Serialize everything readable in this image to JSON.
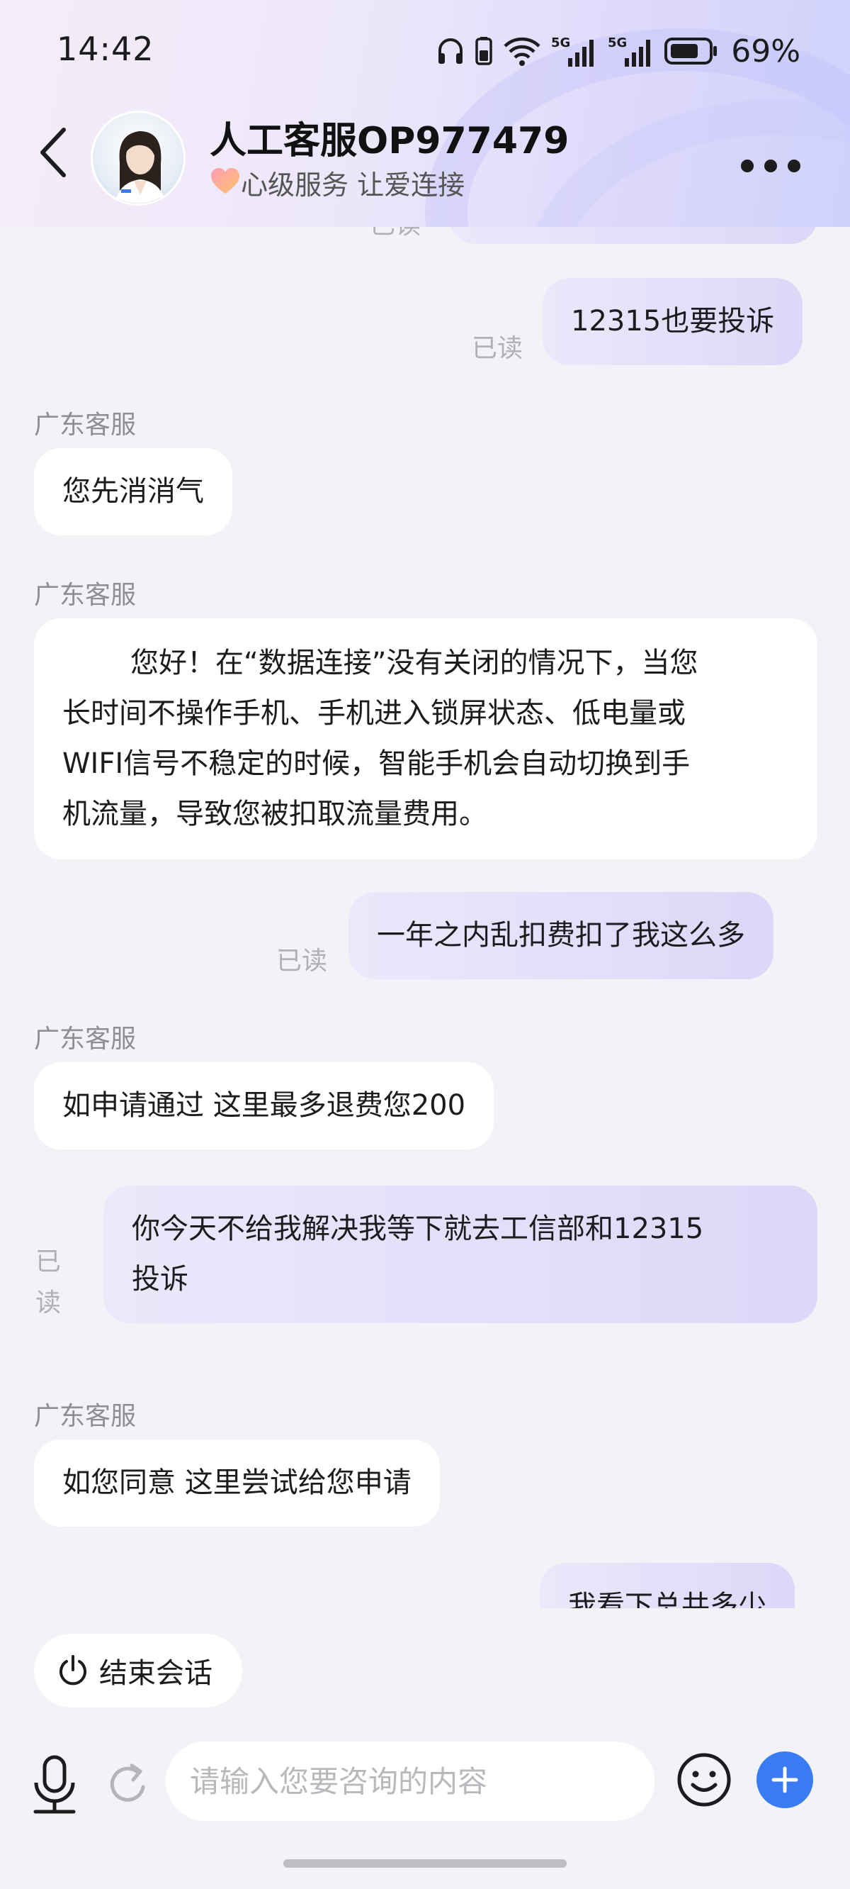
{
  "status_bar": {
    "time": "14:42",
    "battery": "69%"
  },
  "header": {
    "agent_name": "人工客服OP977479",
    "subtitle": "心级服务 让爱连接"
  },
  "messages": {
    "partial_top_read": "已读",
    "m1": {
      "text": "12315也要投诉",
      "read": "已读"
    },
    "m2": {
      "sender": "广东客服",
      "text": "您先消消气"
    },
    "m3": {
      "sender": "广东客服",
      "lines": [
        "您好！在“数据连接”没有关闭的情况下，当您",
        "长时间不操作手机、手机进入锁屏状态、低电量或",
        "WIFI信号不稳定的时候，智能手机会自动切换到手",
        "机流量，导致您被扣取流量费用。"
      ]
    },
    "m4": {
      "text": "一年之内乱扣费扣了我这么多",
      "read": "已读"
    },
    "m5": {
      "sender": "广东客服",
      "text": "如申请通过 这里最多退费您200"
    },
    "m6": {
      "lines": [
        "你今天不给我解决我等下就去工信部和12315",
        "投诉"
      ],
      "read_top": "已",
      "read_bottom": "读"
    },
    "m7": {
      "sender": "广东客服",
      "text": "如您同意 这里尝试给您申请"
    },
    "m8_partial": {
      "text": "我看下总共多少"
    }
  },
  "actions": {
    "end_session": "结束会话"
  },
  "input": {
    "placeholder": "请输入您要咨询的内容"
  },
  "colors": {
    "accent": "#3a7af2",
    "user_bubble": "#e3defa",
    "agent_bubble": "#ffffff"
  }
}
